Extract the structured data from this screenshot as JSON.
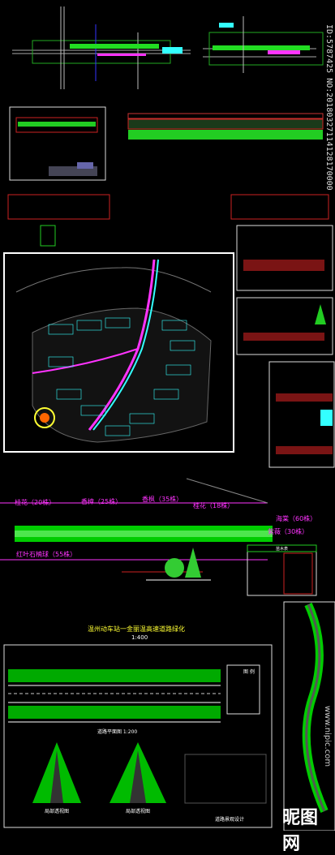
{
  "watermark_id": "ID:5787425 NO:20180327114128170000",
  "site_plan": {
    "labels": {
      "osmanthus_left": "桂花（20株）",
      "camphor": "香樟（25株）",
      "sweetgum": "香枫（35株）",
      "osmanthus_right": "桂花（18株）",
      "crabapple": "海棠（60株）",
      "bamboo": "紫薇（30株）",
      "privet_ball": "红叶石楠球（55株）"
    }
  },
  "section_title": "温州动车站一金丽温高速道路绿化",
  "section_scale": "1:400",
  "road_plan_title": "道路平面图 1:200",
  "bottom_left_caption": "局部透视图",
  "bottom_mid_caption": "局部透视图",
  "bottom_right_caption": "道路景观设计",
  "side_logo": "昵图网",
  "side_url": "www.nipic.com",
  "legend_title": "图  例",
  "table_title": "苗木表",
  "colors": {
    "background": "#000000",
    "cad_green": "#22ff22",
    "cad_magenta": "#ff33ff",
    "cad_cyan": "#33ffff",
    "cad_red": "#cc2222",
    "cad_yellow": "#ffff33"
  }
}
